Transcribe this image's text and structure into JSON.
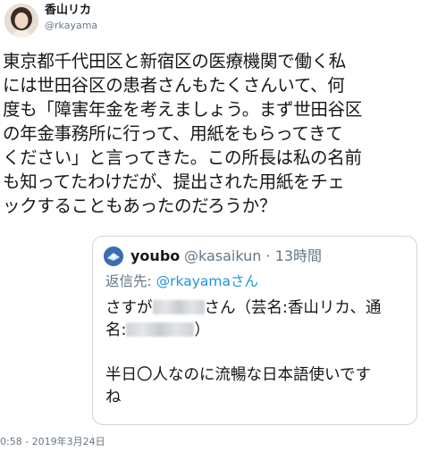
{
  "author": {
    "display_name": "香山リカ",
    "handle": "@rkayama"
  },
  "tweet": {
    "lines": [
      "東京都千代田区と新宿区の医療機関で働く私",
      "には世田谷区の患者さんもたくさんいて、何",
      "度も「障害年金を考えましょう。まず世田谷区",
      "の年金事務所に行って、用紙をもらってきて",
      "ください」と言ってきた。この所長は私の名前",
      "も知ってたわけだが、提出された用紙をチェ",
      "ックすることもあったのだろうか？"
    ],
    "timestamp": "0:58 - 2019年3月24日"
  },
  "quoted_tweet": {
    "name": "youbo",
    "meta": "@kasaikun · 13時間",
    "reply_prefix": "返信先: ",
    "reply_mention": "@rkayamaさん",
    "line1_before": "さすが",
    "line1_after": "さん（芸名:香山リカ、通",
    "line2_before": "名:",
    "line2_after": "）",
    "line3": "",
    "line4": "半日〇人なのに流暢な日本語使いです",
    "line5": "ね"
  },
  "colors": {
    "text": "#14171a",
    "secondary": "#657786",
    "link": "#1b95e0",
    "border": "#ccd6dd"
  }
}
